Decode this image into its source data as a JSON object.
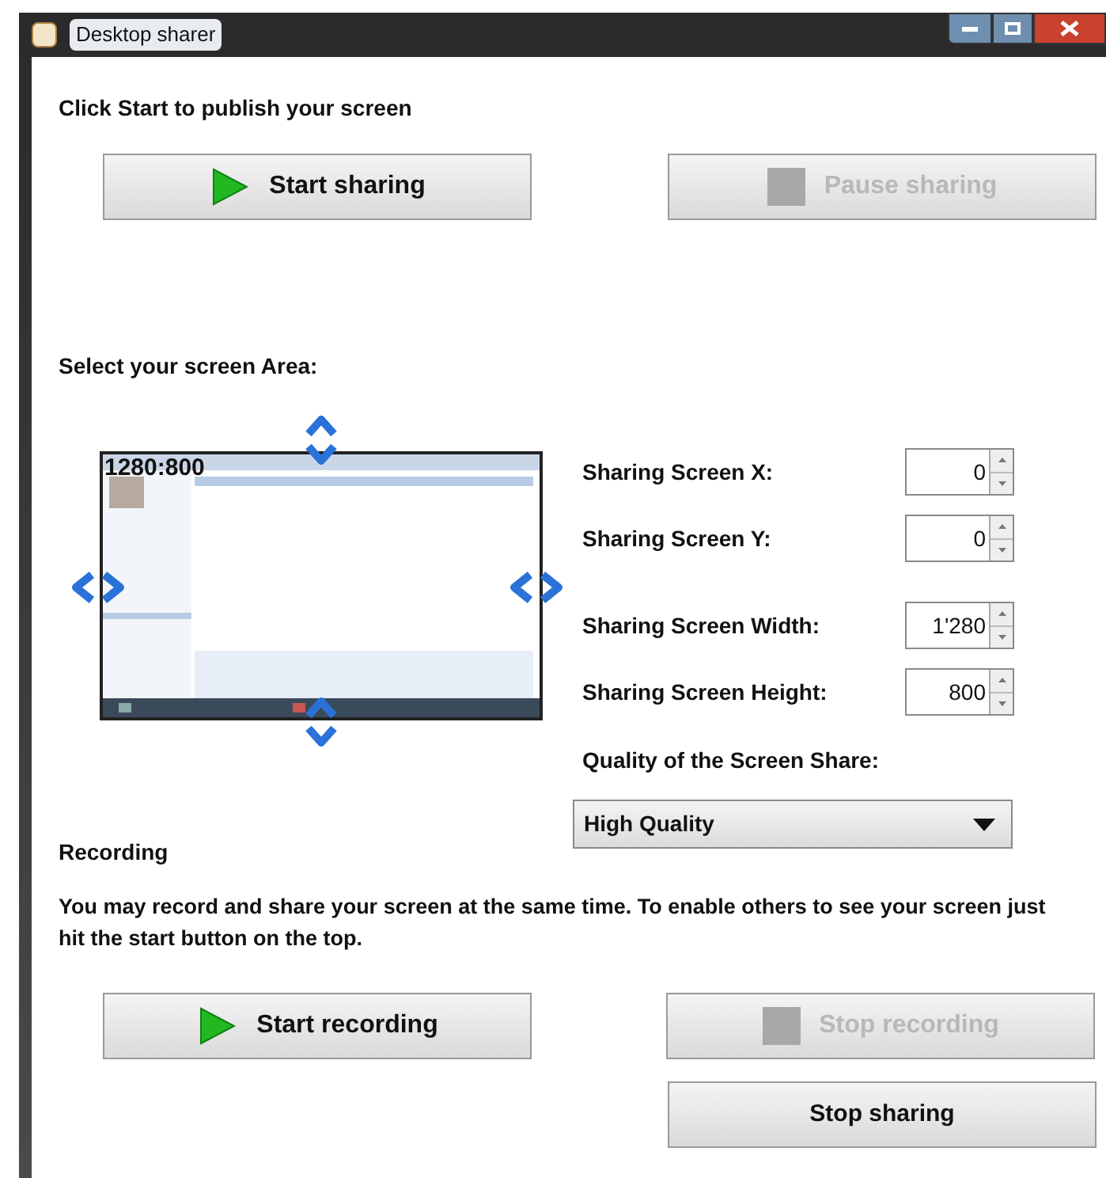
{
  "window": {
    "title": "Desktop sharer"
  },
  "intro": "Click Start to publish your screen",
  "share_buttons": [
    {
      "label": "Start sharing",
      "kind": "play",
      "disabled": false
    },
    {
      "label": "Pause sharing",
      "kind": "stop",
      "disabled": true
    }
  ],
  "area_heading": "Select your screen Area:",
  "preview": {
    "resolution": "1280:800"
  },
  "fields": [
    {
      "label": "Sharing Screen X:",
      "value": "0"
    },
    {
      "label": "Sharing Screen Y:",
      "value": "0"
    },
    {
      "label": "Sharing Screen Width:",
      "value": "1'280"
    },
    {
      "label": "Sharing Screen Height:",
      "value": "800"
    }
  ],
  "quality": {
    "label": "Quality of the Screen Share:",
    "value": "High Quality"
  },
  "recording": {
    "heading": "Recording",
    "text": "You may record and share your screen at the same time. To enable others to see your screen just hit the start button on the top."
  },
  "record_buttons": [
    {
      "label": "Start recording",
      "kind": "play",
      "disabled": false
    },
    {
      "label": "Stop recording",
      "kind": "stop",
      "disabled": true
    }
  ],
  "stop_button": {
    "label": "Stop sharing"
  }
}
